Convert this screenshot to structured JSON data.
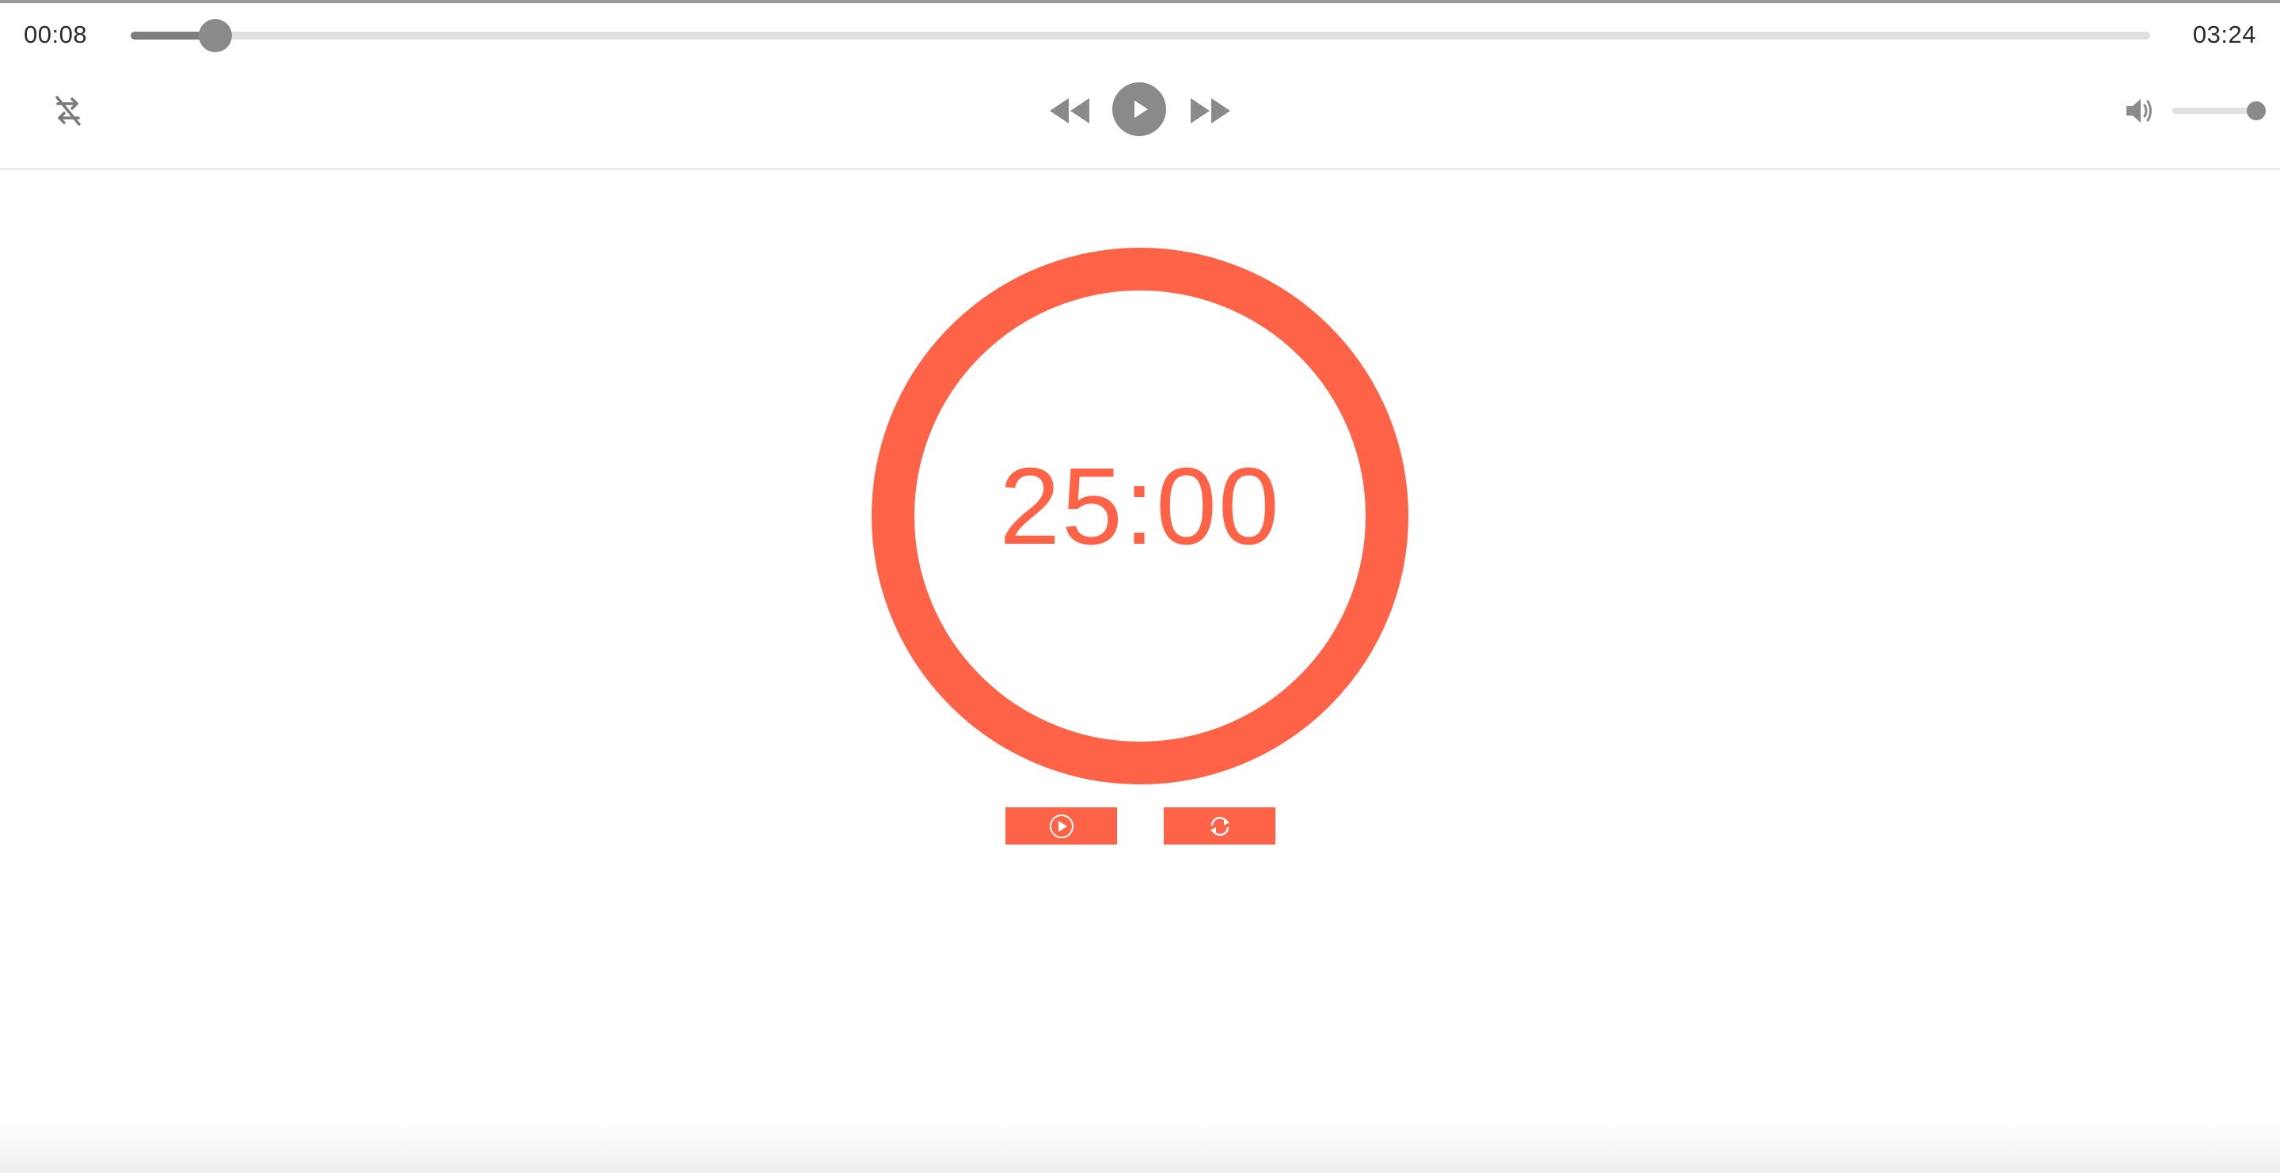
{
  "player": {
    "current_time": "00:08",
    "total_time": "03:24",
    "progress_fraction": 0.042,
    "volume_fraction": 1.0,
    "icons": {
      "shuffle": "shuffle-off-icon",
      "rewind": "rewind-icon",
      "play": "play-icon",
      "forward": "fast-forward-icon",
      "volume": "volume-icon"
    },
    "colors": {
      "control_gray": "#8a8a8a",
      "track_gray": "#e0e0e0"
    }
  },
  "timer": {
    "display": "25:00",
    "ring_color": "#ff6347",
    "buttons": {
      "start_icon": "play-circle-icon",
      "reset_icon": "refresh-icon"
    }
  }
}
